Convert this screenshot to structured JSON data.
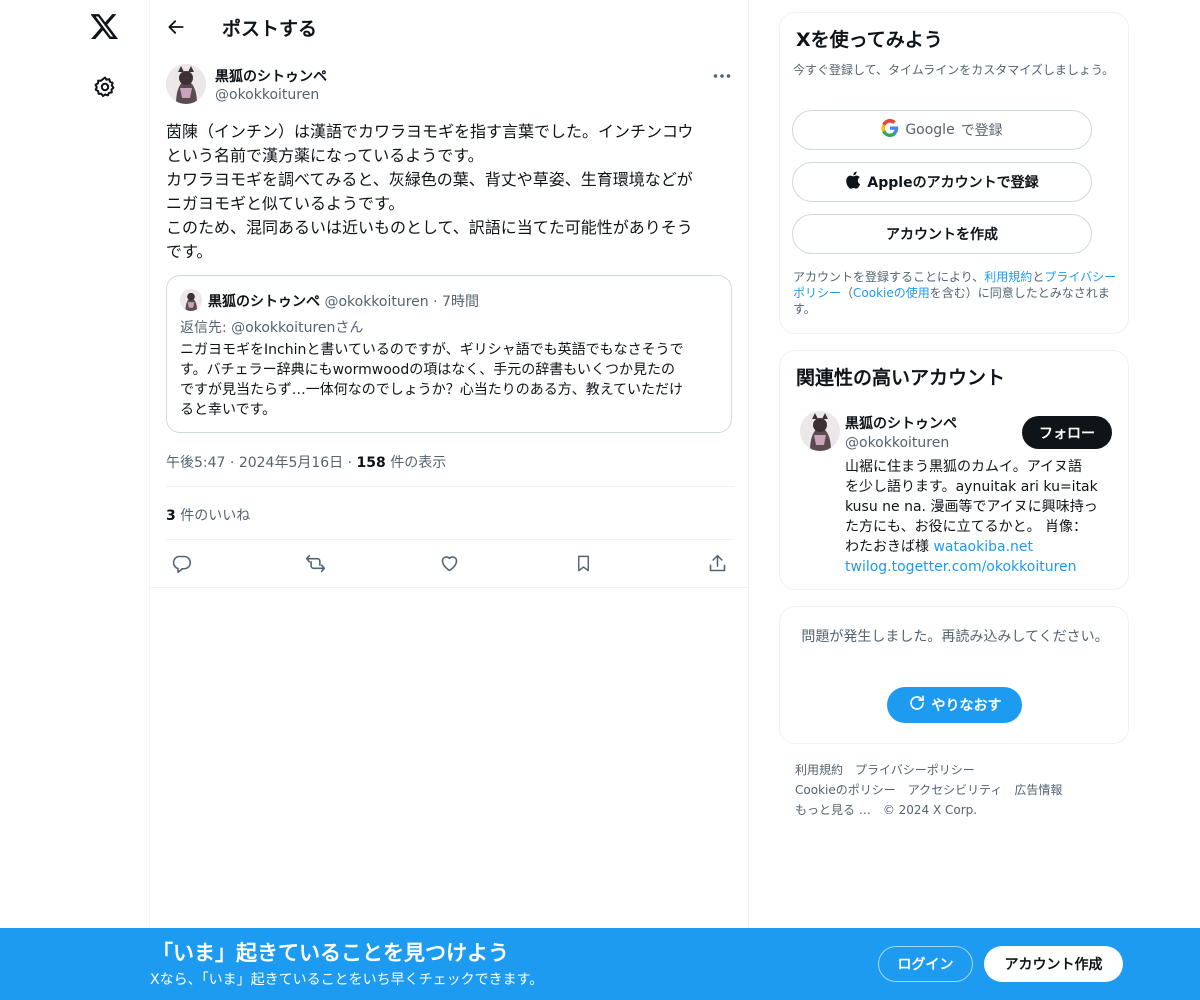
{
  "icons": {
    "x_logo": "x-logo-icon",
    "settings": "gear-icon",
    "back": "arrow-left-icon",
    "more": "more-horizontal-icon",
    "reply": "reply-icon",
    "repost": "repost-icon",
    "like": "heart-icon",
    "bookmark": "bookmark-icon",
    "share": "share-icon",
    "google": "google-icon",
    "apple": "apple-icon",
    "refresh": "refresh-icon"
  },
  "colors": {
    "accent": "#1d9bf0",
    "text": "#0f1419",
    "muted": "#536471",
    "border": "#eff3f4"
  },
  "header": {
    "title": "ポストする"
  },
  "post": {
    "author_name": "黒狐のシトゥンペ",
    "author_handle": "@okokkoituren",
    "body_lines": [
      "茵陳（インチン）は漢語でカワラヨモギを指す言葉でした。インチンコウ",
      "という名前で漢方薬になっているようです。",
      "カワラヨモギを調べてみると、灰緑色の葉、背丈や草姿、生育環境などが",
      "ニガヨモギと似ているようです。",
      "このため、混同あるいは近いものとして、訳語に当てた可能性がありそう",
      "です。"
    ],
    "quote": {
      "author_name": "黒狐のシトゥンペ",
      "author_handle": "@okokkoituren",
      "time": "7時間",
      "reply_to": "返信先: @okokkoiturenさん",
      "body_lines": [
        "ニガヨモギをInchinと書いているのですが、ギリシャ語でも英語でもなさそうで",
        "す。バチェラー辞典にもwormwoodの項はなく、手元の辞書もいくつか見たの",
        "ですが見当たらず…一体何なのでしょうか？心当たりのある方、教えていただけ",
        "ると幸いです。"
      ]
    },
    "time": "午後5:47",
    "date": "2024年5月16日",
    "views_count": "158",
    "views_label": " 件の表示",
    "likes_count": "3",
    "likes_label": " 件のいいね"
  },
  "signup_card": {
    "title": "Xを使ってみよう",
    "subtitle": "今すぐ登録して、タイムラインをカスタマイズしましょう。",
    "google_brand": "Google",
    "google_suffix": "で登録",
    "apple_label": "Appleのアカウントで登録",
    "create_label": "アカウントを作成",
    "terms_prefix": "アカウントを登録することにより、",
    "terms_link1": "利用規約",
    "terms_and": "と",
    "terms_link2": "プライバシーポリシー",
    "terms_paren_open": "（",
    "terms_link3": "Cookieの使用",
    "terms_suffix": "を含む）に同意したとみなされます。"
  },
  "related": {
    "title": "関連性の高いアカウント",
    "name": "黒狐のシトゥンペ",
    "handle": "@okokkoituren",
    "follow_label": "フォロー",
    "bio_lines": [
      "山裾に住まう黒狐のカムイ。アイヌ語",
      "を少し語ります。aynuitak ari ku=itak",
      "kusu ne na. 漫画等でアイヌに興味持っ",
      "た方にも、お役に立てるかと。 肖像："
    ],
    "bio_last_prefix": "わたおきば様 ",
    "link1": "wataokiba.net",
    "link2": "twilog.togetter.com/okokkoituren"
  },
  "error_card": {
    "message": "問題が発生しました。再読み込みしてください。",
    "retry_label": "やりなおす"
  },
  "footer": {
    "links": [
      "利用規約",
      "プライバシーポリシー",
      "Cookieのポリシー",
      "アクセシビリティ",
      "広告情報",
      "もっと見る …"
    ],
    "copyright": "© 2024 X Corp."
  },
  "banner": {
    "title": "「いま」起きていることを見つけよう",
    "subtitle": "Xなら、「いま」起きていることをいち早くチェックできます。",
    "login_label": "ログイン",
    "signup_label": "アカウント作成"
  }
}
